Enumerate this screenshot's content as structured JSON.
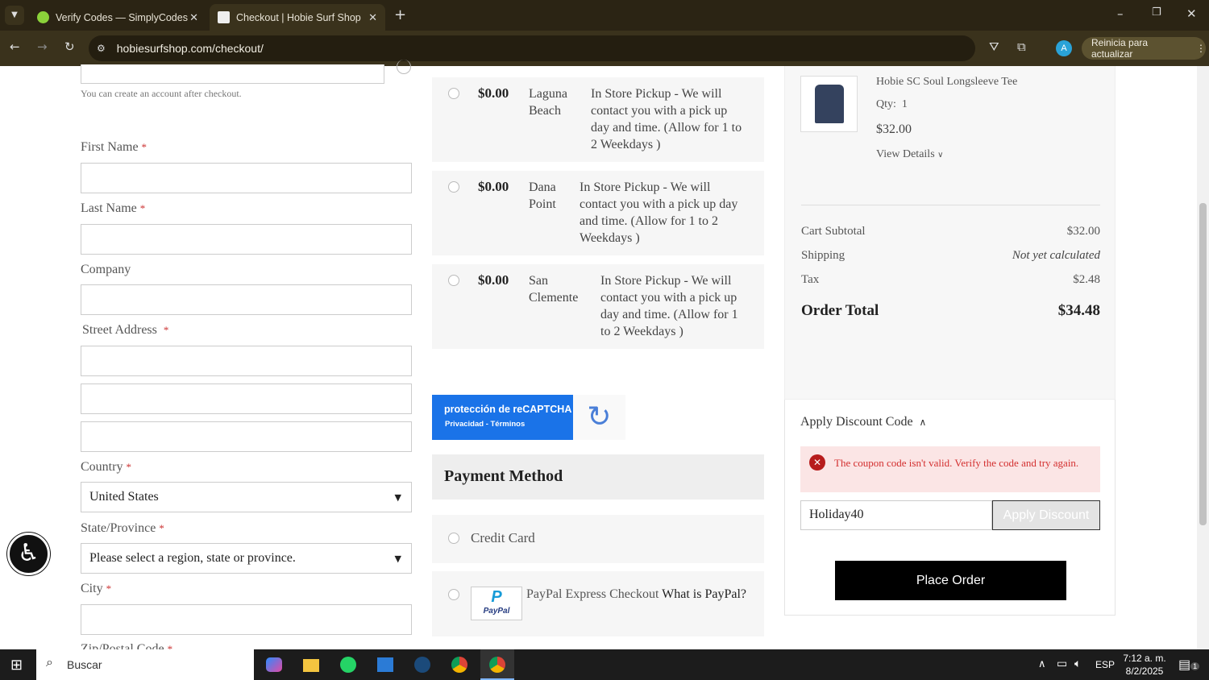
{
  "browser": {
    "tabs": [
      {
        "title": "Verify Codes — SimplyCodes"
      },
      {
        "title": "Checkout | Hobie Surf Shop"
      }
    ],
    "url": "hobiesurfshop.com/checkout/",
    "profile_initial": "A",
    "update_label": "Reinicia para actualizar"
  },
  "form": {
    "account_note": "You can create an account after checkout.",
    "first_name": "First Name",
    "last_name": "Last Name",
    "company": "Company",
    "street": "Street Address",
    "country": "Country",
    "country_value": "United States",
    "state": "State/Province",
    "state_value": "Please select a region, state or province.",
    "city": "City",
    "zip": "Zip/Postal Code",
    "required_mark": "*"
  },
  "shipping": [
    {
      "price": "$0.00",
      "location": "Laguna Beach",
      "desc": "In Store Pickup - We will contact you with a pick up day and time. (Allow for 1 to 2 Weekdays )"
    },
    {
      "price": "$0.00",
      "location": "Dana Point",
      "desc": "In Store Pickup - We will contact you with a pick up day and time. (Allow for 1 to 2 Weekdays )"
    },
    {
      "price": "$0.00",
      "location": "San Clemente",
      "desc": "In Store Pickup - We will contact you with a pick up day and time. (Allow for 1 to 2 Weekdays )"
    }
  ],
  "recaptcha": {
    "title": "protección de reCAPTCHA",
    "links": "Privacidad - Términos"
  },
  "payment": {
    "heading": "Payment Method",
    "credit_card": "Credit Card",
    "paypal": "PayPal Express Checkout",
    "paypal_link": "What is PayPal?",
    "paypal_logo": "PayPal"
  },
  "summary": {
    "product": "Hobie SC Soul Longsleeve Tee",
    "qty_label": "Qty:",
    "qty": "1",
    "price": "$32.00",
    "view_details": "View Details",
    "subtotal_label": "Cart Subtotal",
    "subtotal": "$32.00",
    "shipping_label": "Shipping",
    "shipping": "Not yet calculated",
    "tax_label": "Tax",
    "tax": "$2.48",
    "total_label": "Order Total",
    "total": "$34.48"
  },
  "discount": {
    "heading": "Apply Discount Code",
    "error": "The coupon code isn't valid. Verify the code and try again.",
    "code": "Holiday40",
    "apply": "Apply Discount",
    "place_order": "Place Order"
  },
  "taskbar": {
    "search": "Buscar",
    "lang": "ESP",
    "time": "7:12 a. m.",
    "date": "8/2/2025",
    "notifications": "1"
  }
}
